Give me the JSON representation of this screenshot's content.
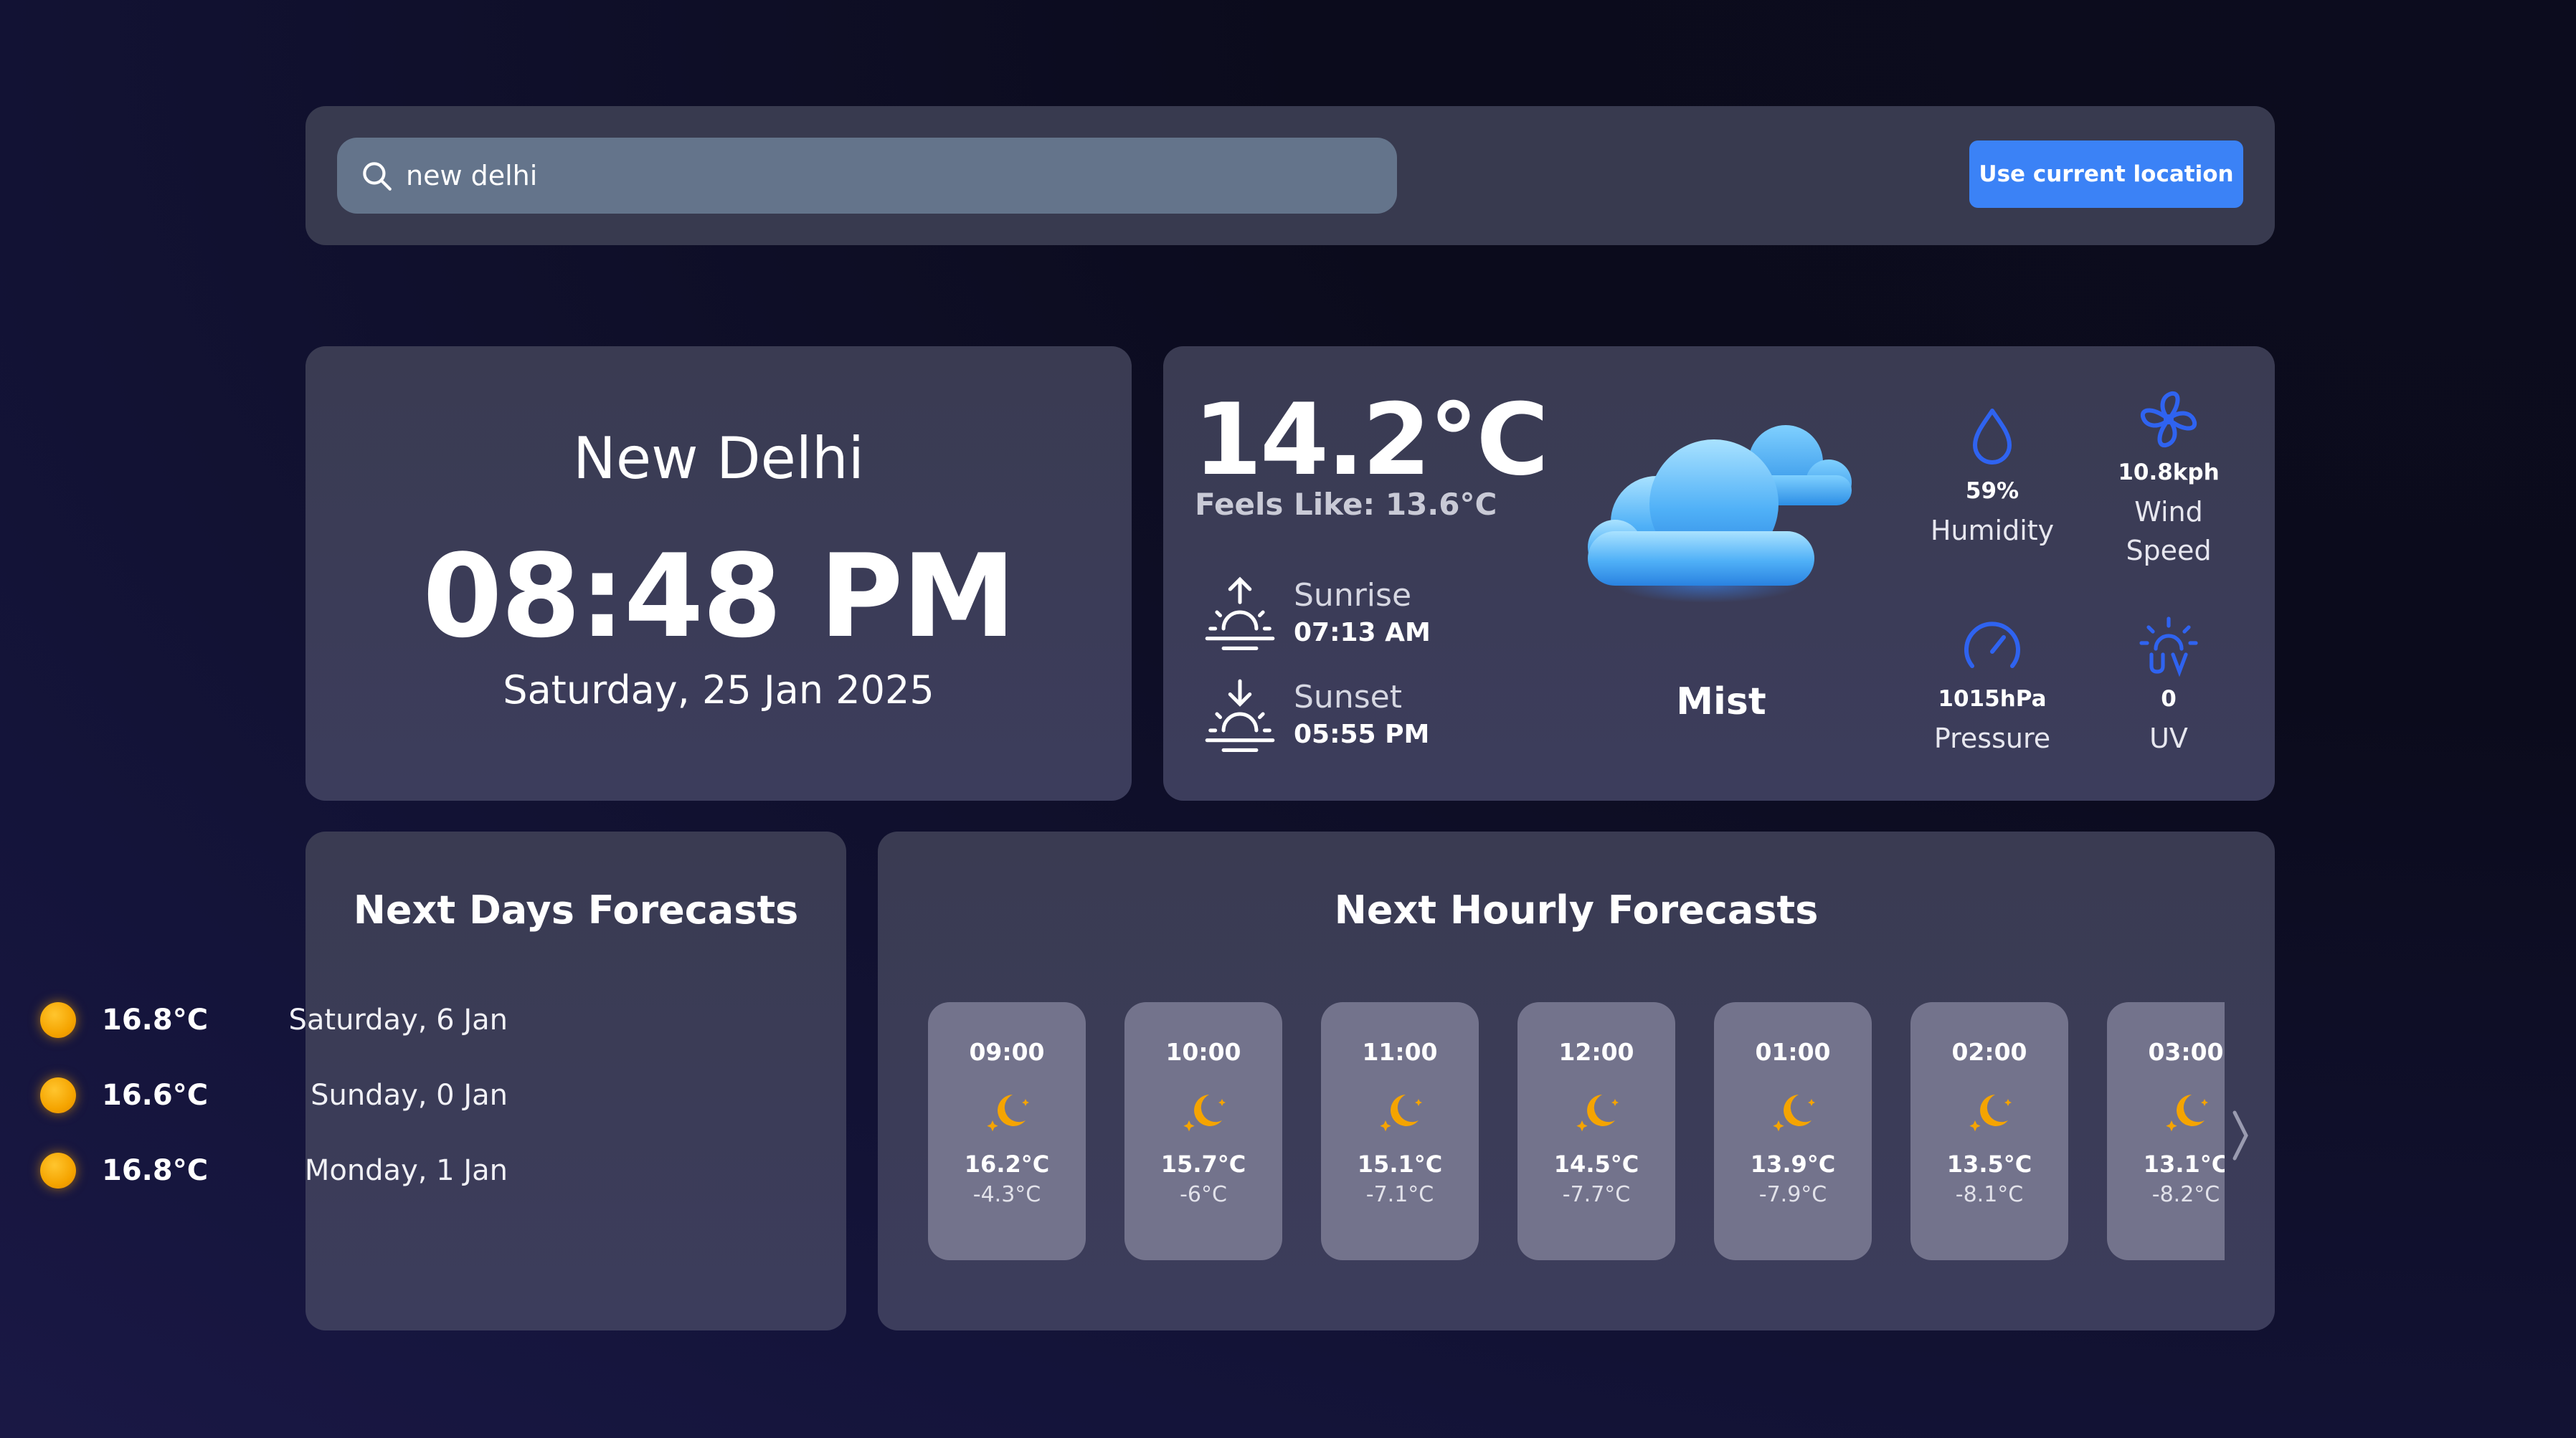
{
  "search": {
    "value": "new delhi",
    "icon": "search-icon",
    "location_button": "Use current location"
  },
  "city": {
    "name": "New Delhi",
    "time": "08:48 PM",
    "date": "Saturday, 25 Jan 2025"
  },
  "current": {
    "temperature": "14.2°C",
    "feels_like": "Feels Like: 13.6°C",
    "sunrise_label": "Sunrise",
    "sunrise_time": "07:13 AM",
    "sunset_label": "Sunset",
    "sunset_time": "05:55 PM",
    "condition": "Mist",
    "condition_icon": "cloud-icon",
    "stats": {
      "humidity": {
        "value": "59%",
        "label": "Humidity",
        "icon": "droplet-icon"
      },
      "wind": {
        "value": "10.8kph",
        "label_line1": "Wind",
        "label_line2": "Speed",
        "icon": "fan-icon"
      },
      "pressure": {
        "value": "1015hPa",
        "label": "Pressure",
        "icon": "gauge-icon"
      },
      "uv": {
        "value": "0",
        "label": "UV",
        "icon": "uv-sun-icon"
      }
    }
  },
  "days": {
    "title": "Next Days Forecasts",
    "items": [
      {
        "temp": "16.8°C",
        "day": "Saturday, 6 Jan"
      },
      {
        "temp": "16.6°C",
        "day": "Sunday, 0 Jan"
      },
      {
        "temp": "16.8°C",
        "day": "Monday, 1 Jan"
      }
    ]
  },
  "hourly": {
    "title": "Next Hourly Forecasts",
    "items": [
      {
        "time": "09:00",
        "temp": "16.2°C",
        "min": "-4.3°C",
        "icon": "moon-icon"
      },
      {
        "time": "10:00",
        "temp": "15.7°C",
        "min": "-6°C",
        "icon": "moon-icon"
      },
      {
        "time": "11:00",
        "temp": "15.1°C",
        "min": "-7.1°C",
        "icon": "moon-icon"
      },
      {
        "time": "12:00",
        "temp": "14.5°C",
        "min": "-7.7°C",
        "icon": "moon-icon"
      },
      {
        "time": "01:00",
        "temp": "13.9°C",
        "min": "-7.9°C",
        "icon": "moon-icon"
      },
      {
        "time": "02:00",
        "temp": "13.5°C",
        "min": "-8.1°C",
        "icon": "moon-icon"
      },
      {
        "time": "03:00",
        "temp": "13.1°C",
        "min": "-8.2°C",
        "icon": "moon-icon"
      }
    ]
  },
  "colors": {
    "accent": "#3b82f6",
    "icon_blue": "#2f63f0",
    "sun_orange": "#f5a400"
  }
}
